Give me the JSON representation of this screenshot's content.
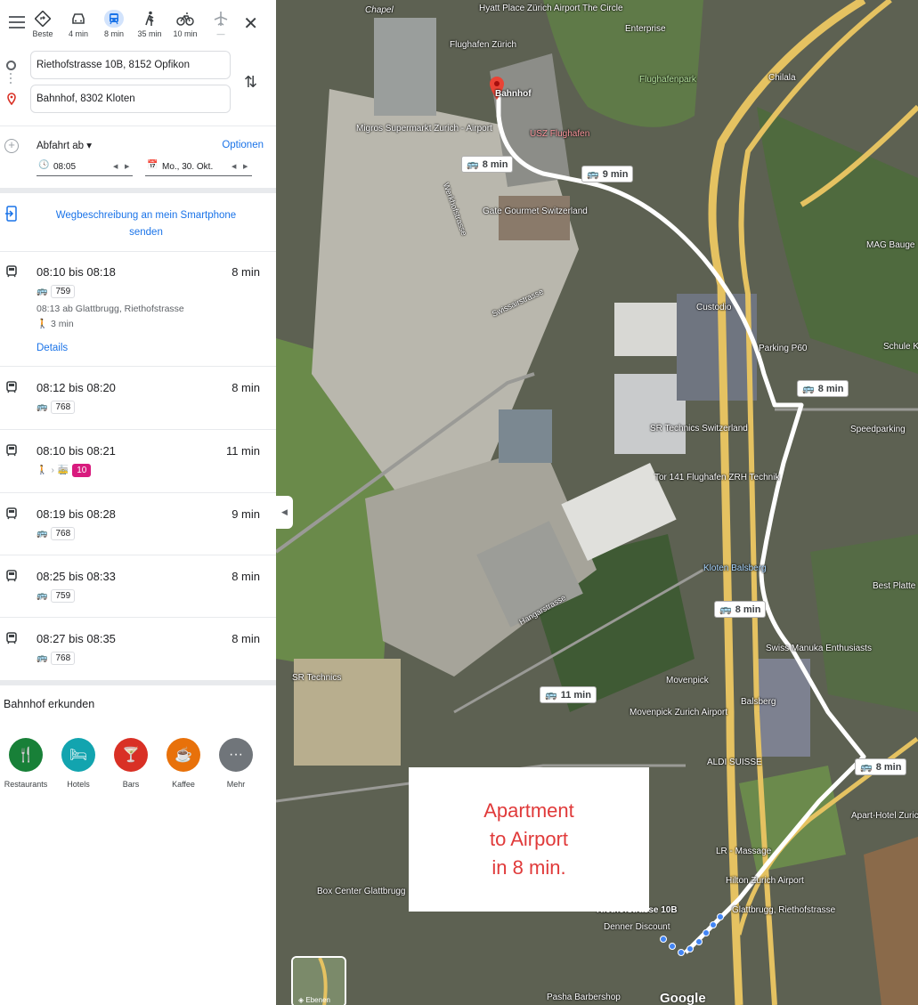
{
  "modes": [
    {
      "label": "Beste",
      "icon": "best-route-icon"
    },
    {
      "label": "4 min",
      "icon": "car-icon"
    },
    {
      "label": "8 min",
      "icon": "transit-icon",
      "active": true
    },
    {
      "label": "35 min",
      "icon": "walk-icon"
    },
    {
      "label": "10 min",
      "icon": "bicycle-icon"
    },
    {
      "label": "—",
      "icon": "flight-icon"
    }
  ],
  "origin": "Riethofstrasse 10B, 8152 Opfikon",
  "destination": "Bahnhof, 8302 Kloten",
  "depart": {
    "label": "Abfahrt ab",
    "options_label": "Optionen",
    "time": "08:05",
    "date": "Mo., 30. Okt."
  },
  "send_to_phone": "Wegbeschreibung an mein Smartphone senden",
  "routes": [
    {
      "times": "08:10 bis 08:18",
      "duration": "8 min",
      "lines": [
        "759"
      ],
      "detail": "08:13 ab Glattbrugg, Riethofstrasse",
      "walk": "3 min",
      "details_link": "Details"
    },
    {
      "times": "08:12 bis 08:20",
      "duration": "8 min",
      "lines": [
        "768"
      ]
    },
    {
      "times": "08:10 bis 08:21",
      "duration": "11 min",
      "lines": [
        "10"
      ],
      "walk_first": true
    },
    {
      "times": "08:19 bis 08:28",
      "duration": "9 min",
      "lines": [
        "768"
      ]
    },
    {
      "times": "08:25 bis 08:33",
      "duration": "8 min",
      "lines": [
        "759"
      ]
    },
    {
      "times": "08:27 bis 08:35",
      "duration": "8 min",
      "lines": [
        "768"
      ]
    }
  ],
  "explore": {
    "title": "Bahnhof erkunden",
    "categories": [
      {
        "label": "Restaurants",
        "icon": "restaurant-icon",
        "color": "#188038"
      },
      {
        "label": "Hotels",
        "icon": "hotel-icon",
        "color": "#12a4af"
      },
      {
        "label": "Bars",
        "icon": "bar-icon",
        "color": "#d93025"
      },
      {
        "label": "Kaffee",
        "icon": "coffee-icon",
        "color": "#e8710a"
      },
      {
        "label": "Mehr",
        "icon": "more-icon",
        "color": "#70757a"
      }
    ]
  },
  "map": {
    "time_chips": [
      "8 min",
      "9 min",
      "8 min",
      "8 min",
      "11 min",
      "8 min"
    ],
    "labels": {
      "hyatt": "Hyatt Place Zürich Airport The Circle",
      "flughafen": "Flughafen Zürich",
      "bahnhof": "Bahnhof",
      "enterprise": "Enterprise",
      "flughafenpark": "Flughafenpark",
      "chilala": "Chilala",
      "migros": "Migros Supermarkt Zurich - Airport",
      "usz": "USZ Flughafen",
      "gate": "Gate Gourmet Switzerland",
      "custodio": "Custodio",
      "parking": "Parking P60",
      "mag": "MAG Bauge",
      "schule": "Schule K",
      "speedparking": "Speedparking",
      "sr": "SR Technics Switzerland",
      "tor": "Tor 141 Flughafen ZRH Technik",
      "kloten_balsberg": "Kloten Balsberg",
      "best": "Best Platte",
      "swiss_manuka": "Swiss Manuka Enthusiasts",
      "moevenpick1": "Movenpick",
      "moevenpick2": "Movenpick Zurich Airport",
      "balsberg": "Balsberg",
      "aldi": "ALDI SUISSE",
      "apart": "Apart-Hotel Zurich Airport",
      "sr2": "SR Technics",
      "lr": "LR - Massage",
      "hilton": "Hilton Zurich Airport",
      "riethof_addr": "Riethofstrasse 10B",
      "glattbrugg_stop": "Glattbrugg, Riethofstrasse",
      "denner": "Denner Discount",
      "box": "Box Center Glattbrugg",
      "pasha": "Pasha Barbershop",
      "werkhof": "Werkhofstrasse",
      "hangar": "Hangarstrasse",
      "swiss_str": "Swissairstrasse",
      "chapel": "Chapel"
    },
    "note": [
      "Apartment",
      "to Airport",
      "in 8 min."
    ],
    "layers_label": "Ebenen",
    "google": "Google"
  }
}
